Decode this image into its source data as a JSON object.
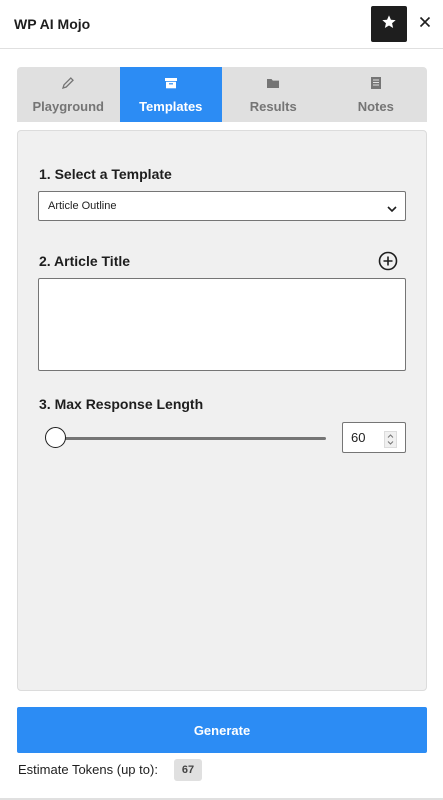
{
  "app": {
    "title": "WP AI Mojo"
  },
  "header": {
    "star_icon": "star-icon",
    "close_icon": "close-icon"
  },
  "tabs": [
    {
      "label": "Playground",
      "icon": "pencil-icon",
      "active": false
    },
    {
      "label": "Templates",
      "icon": "archive-box-icon",
      "active": true
    },
    {
      "label": "Results",
      "icon": "folder-icon",
      "active": false
    },
    {
      "label": "Notes",
      "icon": "document-icon",
      "active": false
    }
  ],
  "form": {
    "template_label": "1. Select a Template",
    "template_value": "Article Outline",
    "title_label": "2. Article Title",
    "title_value": "",
    "length_label": "3. Max Response Length",
    "length_value": "60",
    "length_slider_fraction": 0.0
  },
  "footer": {
    "generate_label": "Generate",
    "tokens_label": "Estimate Tokens (up to):",
    "tokens_value": "67"
  },
  "colors": {
    "accent": "#2c8cf4",
    "dark": "#1e1e1e",
    "tab_bg": "#e0e0e0",
    "panel_bg": "#f0f0f0"
  }
}
